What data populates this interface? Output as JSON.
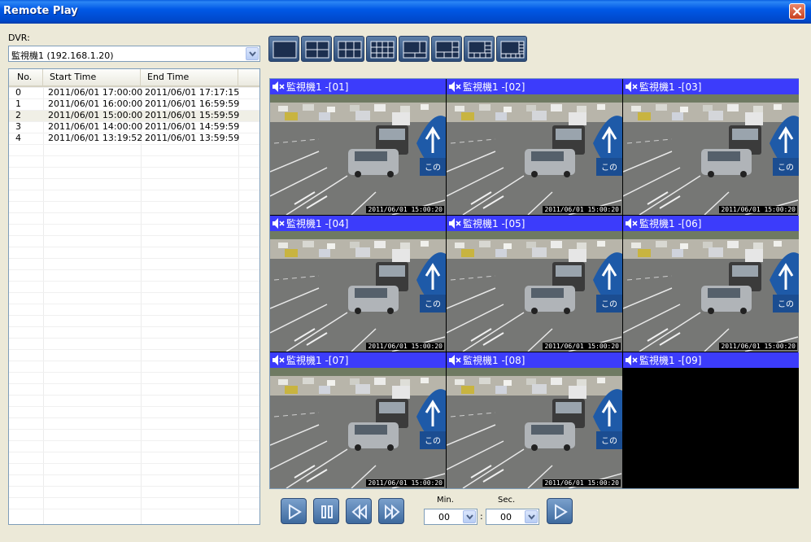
{
  "window": {
    "title": "Remote Play",
    "close_icon": "close-icon"
  },
  "dvr": {
    "label": "DVR:",
    "selected": "監視機1 (192.168.1.20)"
  },
  "list": {
    "columns": {
      "no": "No.",
      "start": "Start Time",
      "end": "End Time"
    },
    "rows": [
      {
        "no": "0",
        "start": "2011/06/01 17:00:00",
        "end": "2011/06/01 17:17:15"
      },
      {
        "no": "1",
        "start": "2011/06/01 16:00:00",
        "end": "2011/06/01 16:59:59"
      },
      {
        "no": "2",
        "start": "2011/06/01 15:00:00",
        "end": "2011/06/01 15:59:59"
      },
      {
        "no": "3",
        "start": "2011/06/01 14:00:00",
        "end": "2011/06/01 14:59:59"
      },
      {
        "no": "4",
        "start": "2011/06/01 13:19:52",
        "end": "2011/06/01 13:59:59"
      }
    ],
    "selected_index": 2
  },
  "layout_buttons": [
    "layout-1-icon",
    "layout-4-icon",
    "layout-6-icon",
    "layout-9-icon",
    "layout-5-icon",
    "layout-8-icon",
    "layout-10-icon",
    "layout-13-icon"
  ],
  "cameras": [
    {
      "label": "監視機1 -[01]",
      "timestamp": "2011/06/01 15:00:20",
      "has_video": true
    },
    {
      "label": "監視機1 -[02]",
      "timestamp": "2011/06/01 15:00:20",
      "has_video": true
    },
    {
      "label": "監視機1 -[03]",
      "timestamp": "2011/06/01 15:00:20",
      "has_video": true
    },
    {
      "label": "監視機1 -[04]",
      "timestamp": "2011/06/01 15:00:20",
      "has_video": true
    },
    {
      "label": "監視機1 -[05]",
      "timestamp": "2011/06/01 15:00:20",
      "has_video": true
    },
    {
      "label": "監視機1 -[06]",
      "timestamp": "2011/06/01 15:00:20",
      "has_video": true
    },
    {
      "label": "監視機1 -[07]",
      "timestamp": "2011/06/01 15:00:20",
      "has_video": true
    },
    {
      "label": "監視機1 -[08]",
      "timestamp": "2011/06/01 15:00:20",
      "has_video": true
    },
    {
      "label": "監視機1 -[09]",
      "timestamp": "",
      "has_video": false
    }
  ],
  "playback": {
    "buttons": [
      "play-icon",
      "pause-icon",
      "rewind-icon",
      "fast-forward-icon"
    ],
    "min_label": "Min.",
    "sec_label": "Sec.",
    "min_value": "00",
    "sec_value": "00",
    "separator": ":",
    "go_icon": "play-icon"
  },
  "colors": {
    "title_bar": "#0055e5",
    "camera_header": "#3c3cfb",
    "background": "#ece9d8"
  }
}
